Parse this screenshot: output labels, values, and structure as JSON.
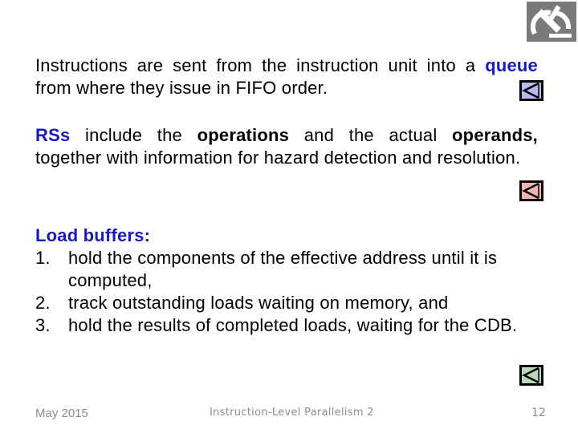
{
  "logo": {
    "icon": "microscope-logo-icon"
  },
  "paragraph1": {
    "text_before": "Instructions are sent from the instruction unit into a ",
    "highlight": "queue",
    "text_after": " from where they issue in FIFO order."
  },
  "paragraph2": {
    "highlight": "RSs",
    "text1": " include the ",
    "bold1": "operations",
    "text2": " and the actual ",
    "bold2": "operands,",
    "text3": " together with information for hazard detection and resolution."
  },
  "paragraph3": {
    "heading": "Load buffers:",
    "items": [
      {
        "num": "1.",
        "text": "hold the components of the effective address until it is computed,"
      },
      {
        "num": "2.",
        "text": "track outstanding loads waiting on memory, and"
      },
      {
        "num": "3.",
        "text": "hold the results of completed loads, waiting for the CDB."
      }
    ]
  },
  "nav_buttons": [
    {
      "icon": "back-arrow-icon",
      "color": "#b9b9f0"
    },
    {
      "icon": "back-arrow-icon",
      "color": "#f2b3b3"
    },
    {
      "icon": "back-arrow-icon",
      "color": "#b9d8b9"
    }
  ],
  "footer": {
    "date": "May 2015",
    "title": "Instruction-Level Parallelism 2",
    "page": "12"
  },
  "colors": {
    "accent_blue": "#1a1ab8",
    "footer_gray": "#8c8c8c"
  }
}
